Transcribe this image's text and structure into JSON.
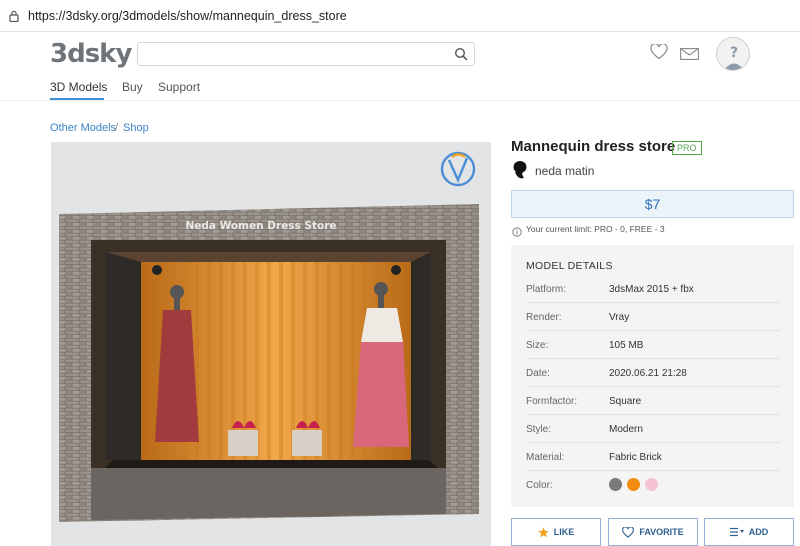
{
  "browser": {
    "url": "https://3dsky.org/3dmodels/show/mannequin_dress_store"
  },
  "header": {
    "logo": "3dsky",
    "search_placeholder": "",
    "nav": [
      "3D Models",
      "Buy",
      "Support"
    ]
  },
  "breadcrumb": [
    "Other Models",
    "Shop"
  ],
  "model": {
    "title": "Mannequin dress store",
    "badge": "PRO",
    "author": "neda matin",
    "price": "$7",
    "limit": "Your current limit: PRO - 0, FREE - 3",
    "preview_sign": "Neda Women Dress Store"
  },
  "details": {
    "heading": "MODEL DETAILS",
    "rows": [
      {
        "key": "Platform:",
        "value": "3dsMax 2015 + fbx"
      },
      {
        "key": "Render:",
        "value": "Vray"
      },
      {
        "key": "Size:",
        "value": "105 MB"
      },
      {
        "key": "Date:",
        "value": "2020.06.21 21:28"
      },
      {
        "key": "Formfactor:",
        "value": "Square"
      },
      {
        "key": "Style:",
        "value": "Modern"
      },
      {
        "key": "Material:",
        "value": "Fabric Brick"
      },
      {
        "key": "Color:",
        "value": ""
      }
    ],
    "colors": [
      "#7a7a7a",
      "#f28c0f",
      "#f6c3d2"
    ]
  },
  "actions": {
    "like": "LIKE",
    "favorite": "FAVORITE",
    "add": "ADD"
  }
}
